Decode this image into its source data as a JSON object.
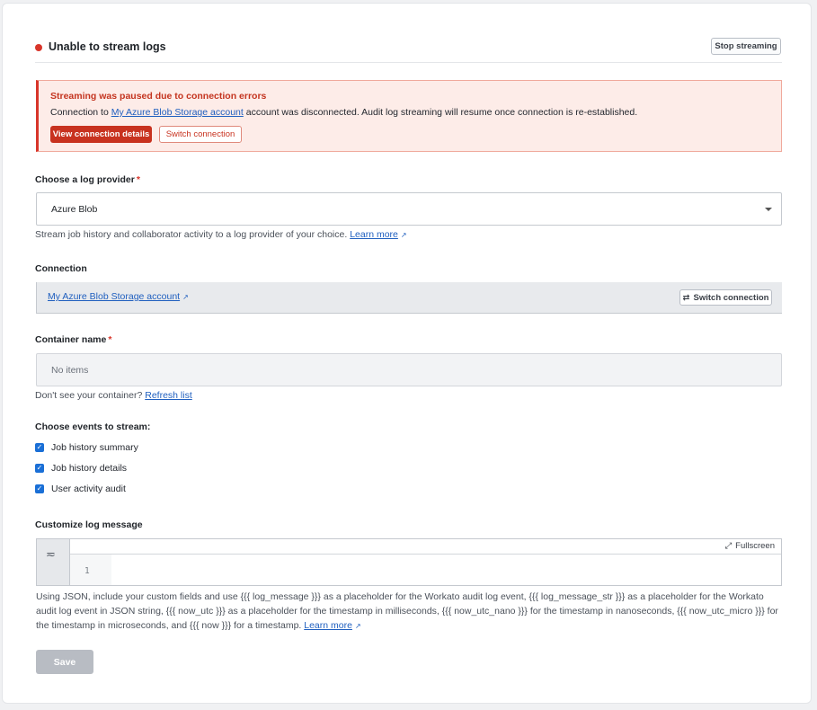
{
  "header": {
    "title": "Unable to stream logs",
    "stop_button": "Stop streaming",
    "status_color": "#d8352a"
  },
  "alert": {
    "title": "Streaming was paused due to connection errors",
    "body_prefix": "Connection to ",
    "body_link": "My Azure Blob Storage account",
    "body_suffix": " account was disconnected. Audit log streaming will resume once connection is re-established.",
    "primary_button": "View connection details",
    "secondary_button": "Switch connection"
  },
  "provider": {
    "label": "Choose a log provider",
    "required_mark": "*",
    "selected": "Azure Blob",
    "help_text": "Stream job history and collaborator activity to a log provider of your choice.",
    "help_link": "Learn more"
  },
  "connection": {
    "label": "Connection",
    "account_link": "My Azure Blob Storage account",
    "switch_button": "Switch connection"
  },
  "container": {
    "label": "Container name",
    "required_mark": "*",
    "placeholder": "No items",
    "help_text": "Don't see your container?",
    "refresh_link": "Refresh list"
  },
  "events": {
    "label": "Choose events to stream:",
    "items": [
      {
        "label": "Job history summary",
        "checked": true
      },
      {
        "label": "Job history details",
        "checked": true
      },
      {
        "label": "User activity audit",
        "checked": true
      }
    ]
  },
  "log_message": {
    "label": "Customize log message",
    "fullscreen": "Fullscreen",
    "line_number": "1",
    "description": "Using JSON, include your custom fields and use {{{ log_message }}} as a placeholder for the Workato audit log event, {{{ log_message_str }}} as a placeholder for the Workato audit log event in JSON string, {{{ now_utc }}} as a placeholder for the timestamp in milliseconds, {{{ now_utc_nano }}} for the timestamp in nanoseconds, {{{ now_utc_micro }}} for the timestamp in microseconds, and {{{ now }}} for a timestamp.",
    "learn_more": "Learn more"
  },
  "save_button": "Save"
}
